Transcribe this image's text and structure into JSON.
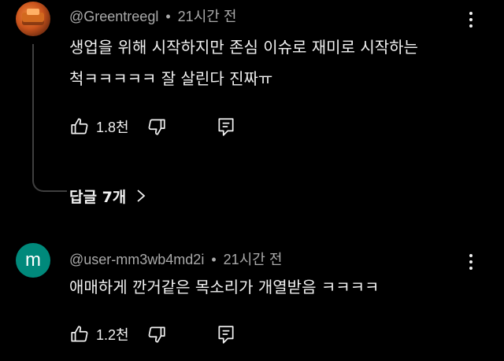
{
  "comments": [
    {
      "author": "@Greentreegl",
      "time": "21시간 전",
      "lines": [
        "생업을 위해 시작하지만 존심 이슈로 재미로 시작하는",
        "척ㅋㅋㅋㅋㅋ 잘 살린다 진짜ㅠ"
      ],
      "likes": "1.8천",
      "avatar_icon": "profile-photo",
      "replies_label": "답글 7개"
    },
    {
      "author": "@user-mm3wb4md2i",
      "time": "21시간 전",
      "lines": [
        "애매하게 깐거같은 목소리가 개열받음 ㅋㅋㅋㅋ"
      ],
      "likes": "1.2천",
      "avatar_letter": "m"
    }
  ],
  "separator": "•",
  "icons": {
    "like": "thumbs-up-icon",
    "dislike": "thumbs-down-icon",
    "reply": "comment-reply-icon",
    "menu": "more-vert-icon",
    "expand": "chevron-right-icon"
  },
  "colors": {
    "background": "#000000",
    "text": "#f1f1f1",
    "meta": "#aaaaaa",
    "avatar_bg": "#00897b"
  }
}
